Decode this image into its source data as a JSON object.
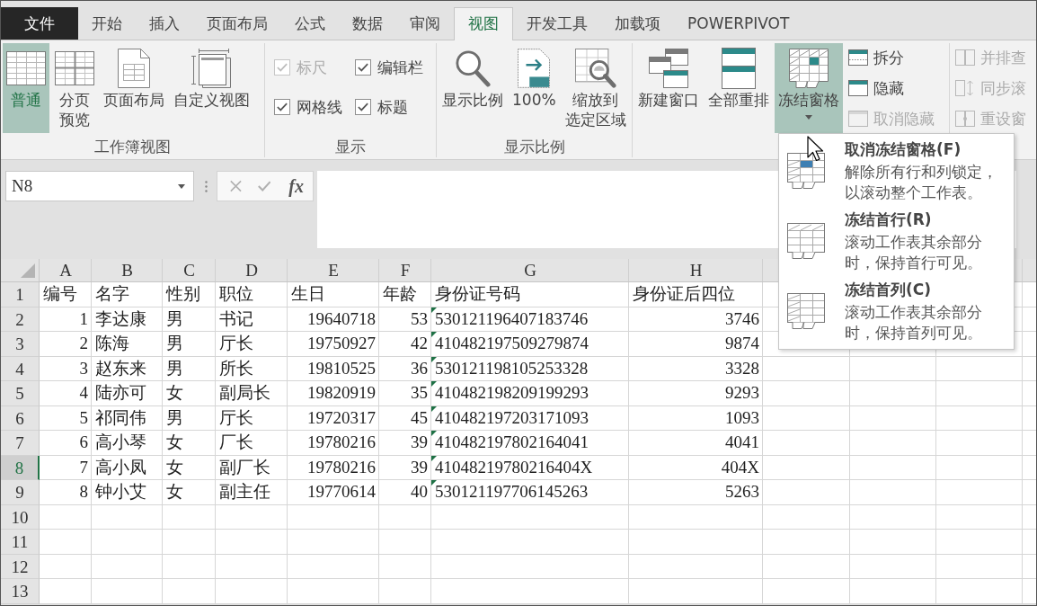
{
  "tabs": [
    {
      "label": "文件",
      "kind": "file",
      "selected": false
    },
    {
      "label": "开始",
      "kind": "tab",
      "selected": false
    },
    {
      "label": "插入",
      "kind": "tab",
      "selected": false
    },
    {
      "label": "页面布局",
      "kind": "tab",
      "selected": false
    },
    {
      "label": "公式",
      "kind": "tab",
      "selected": false
    },
    {
      "label": "数据",
      "kind": "tab",
      "selected": false
    },
    {
      "label": "审阅",
      "kind": "tab",
      "selected": false
    },
    {
      "label": "视图",
      "kind": "tab",
      "selected": true
    },
    {
      "label": "开发工具",
      "kind": "tab",
      "selected": false
    },
    {
      "label": "加载项",
      "kind": "tab",
      "selected": false
    },
    {
      "label": "POWERPIVOT",
      "kind": "tab",
      "selected": false
    }
  ],
  "ribbon": {
    "groups": [
      {
        "label": "工作簿视图",
        "buttons": [
          {
            "kind": "large",
            "label": "普通",
            "selected": true,
            "disabled": false
          },
          {
            "kind": "large",
            "label": "分页预览",
            "selected": false,
            "disabled": false
          },
          {
            "kind": "large",
            "label": "页面布局",
            "selected": false,
            "disabled": false
          },
          {
            "kind": "large",
            "label": "自定义视图",
            "selected": false,
            "disabled": false
          }
        ]
      },
      {
        "label": "显示",
        "checkboxes": [
          {
            "label": "标尺",
            "checked": true,
            "disabled": true
          },
          {
            "label": "编辑栏",
            "checked": true,
            "disabled": false
          },
          {
            "label": "网格线",
            "checked": true,
            "disabled": false
          },
          {
            "label": "标题",
            "checked": true,
            "disabled": false
          }
        ]
      },
      {
        "label": "显示比例",
        "buttons": [
          {
            "kind": "large",
            "label": "显示比例",
            "selected": false,
            "disabled": false
          },
          {
            "kind": "large",
            "label": "100%",
            "selected": false,
            "disabled": false
          },
          {
            "kind": "large",
            "label": "缩放到选定区域",
            "selected": false,
            "disabled": false
          }
        ]
      },
      {
        "buttons": [
          {
            "kind": "large",
            "label": "新建窗口",
            "selected": false,
            "disabled": false
          },
          {
            "kind": "large",
            "label": "全部重排",
            "selected": false,
            "disabled": false
          },
          {
            "kind": "dropdown",
            "label": "冻结窗格",
            "expanded": true,
            "disabled": false,
            "menu": {
              "items": [
                {
                  "title": "取消冻结窗格(F)",
                  "description": "解除所有行和列锁定，以滚动整个工作表。"
                },
                {
                  "title": "冻结首行(R)",
                  "description": "滚动工作表其余部分时，保持首行可见。"
                },
                {
                  "title": "冻结首列(C)",
                  "description": "滚动工作表其余部分时，保持首列可见。"
                }
              ]
            }
          }
        ],
        "small_buttons": [
          {
            "label": "拆分",
            "disabled": false
          },
          {
            "label": "隐藏",
            "disabled": false
          },
          {
            "label": "取消隐藏",
            "disabled": true
          }
        ]
      },
      {
        "small_buttons": [
          {
            "label": "并排查",
            "disabled": true
          },
          {
            "label": "同步滚",
            "disabled": true
          },
          {
            "label": "重设窗",
            "disabled": true
          }
        ]
      }
    ]
  },
  "formula_bar": {
    "name_box": "N8",
    "function_label": "fx"
  },
  "sheet": {
    "columns": [
      {
        "letter": "A",
        "kind": "number",
        "flagged": false
      },
      {
        "letter": "B",
        "kind": "text",
        "flagged": false
      },
      {
        "letter": "C",
        "kind": "text",
        "flagged": false
      },
      {
        "letter": "D",
        "kind": "text",
        "flagged": false
      },
      {
        "letter": "E",
        "kind": "number",
        "flagged": false
      },
      {
        "letter": "F",
        "kind": "number",
        "flagged": false
      },
      {
        "letter": "G",
        "kind": "text",
        "flagged": true
      },
      {
        "letter": "H",
        "kind": "number",
        "flagged": false
      }
    ],
    "rows": [
      {
        "number": "1",
        "kind": "header",
        "selected": false,
        "cells": [
          "编号",
          "名字",
          "性别",
          "职位",
          "生日",
          "年龄",
          "身份证号码",
          "身份证后四位"
        ]
      },
      {
        "number": "2",
        "kind": "data",
        "selected": false,
        "cells": [
          "1",
          "李达康",
          "男",
          "书记",
          "19640718",
          "53",
          "530121196407183746",
          "3746"
        ]
      },
      {
        "number": "3",
        "kind": "data",
        "selected": false,
        "cells": [
          "2",
          "陈海",
          "男",
          "厅长",
          "19750927",
          "42",
          "410482197509279874",
          "9874"
        ]
      },
      {
        "number": "4",
        "kind": "data",
        "selected": false,
        "cells": [
          "3",
          "赵东来",
          "男",
          "所长",
          "19810525",
          "36",
          "530121198105253328",
          "3328"
        ]
      },
      {
        "number": "5",
        "kind": "data",
        "selected": false,
        "cells": [
          "4",
          "陆亦可",
          "女",
          "副局长",
          "19820919",
          "35",
          "410482198209199293",
          "9293"
        ]
      },
      {
        "number": "6",
        "kind": "data",
        "selected": false,
        "cells": [
          "5",
          "祁同伟",
          "男",
          "厅长",
          "19720317",
          "45",
          "410482197203171093",
          "1093"
        ]
      },
      {
        "number": "7",
        "kind": "data",
        "selected": false,
        "cells": [
          "6",
          "高小琴",
          "女",
          "厂长",
          "19780216",
          "39",
          "410482197802164041",
          "4041"
        ]
      },
      {
        "number": "8",
        "kind": "data",
        "selected": true,
        "cells": [
          "7",
          "高小凤",
          "女",
          "副厂长",
          "19780216",
          "39",
          "41048219780216404X",
          "404X"
        ]
      },
      {
        "number": "9",
        "kind": "data",
        "selected": false,
        "cells": [
          "8",
          "钟小艾",
          "女",
          "副主任",
          "19770614",
          "40",
          "530121197706145263",
          "5263"
        ]
      },
      {
        "number": "10",
        "kind": "blank",
        "selected": false
      },
      {
        "number": "11",
        "kind": "blank",
        "selected": false
      },
      {
        "number": "12",
        "kind": "blank",
        "selected": false
      },
      {
        "number": "13",
        "kind": "blank",
        "selected": false
      }
    ]
  }
}
